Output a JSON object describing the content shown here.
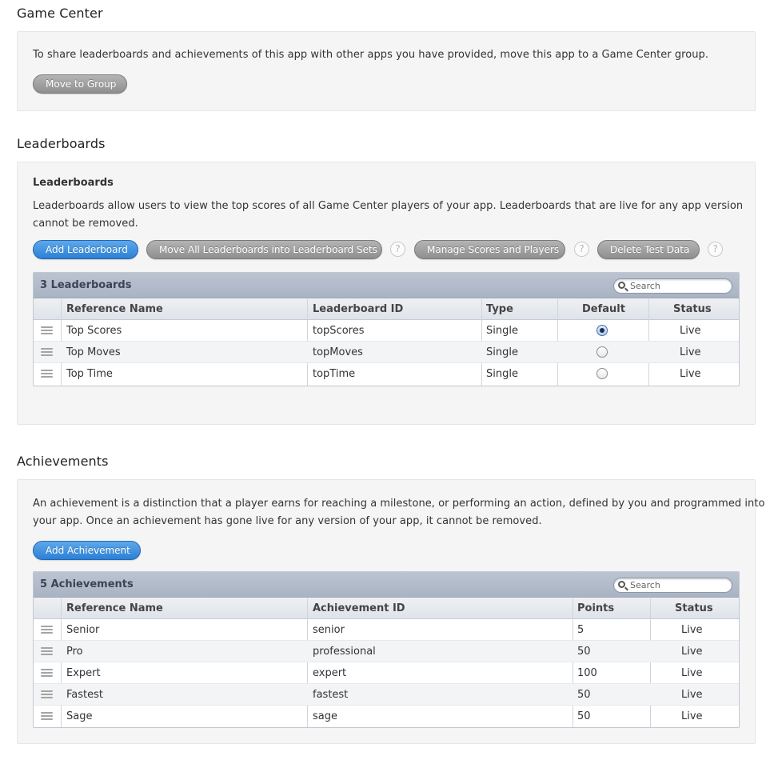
{
  "game_center": {
    "title": "Game Center",
    "description": "To share leaderboards and achievements of this app with other apps you have provided, move this app to a Game Center group.",
    "move_button": "Move to Group"
  },
  "leaderboards": {
    "title": "Leaderboards",
    "panel_heading": "Leaderboards",
    "description_line1": "Leaderboards allow users to view the top scores of all Game Center players of your app. Leaderboards that are live for any app version",
    "description_line2": "cannot be removed.",
    "buttons": {
      "add": "Add Leaderboard",
      "move_all": "Move All Leaderboards into Leaderboard Sets",
      "manage": "Manage Scores and Players",
      "delete": "Delete Test Data"
    },
    "help_glyph": "?",
    "table": {
      "title": "3 Leaderboards",
      "search_placeholder": "Search",
      "headers": {
        "reference_name": "Reference Name",
        "leaderboard_id": "Leaderboard ID",
        "type": "Type",
        "default": "Default",
        "status": "Status"
      },
      "rows": [
        {
          "reference_name": "Top Scores",
          "leaderboard_id": "topScores",
          "type": "Single",
          "default": true,
          "status": "Live"
        },
        {
          "reference_name": "Top Moves",
          "leaderboard_id": "topMoves",
          "type": "Single",
          "default": false,
          "status": "Live"
        },
        {
          "reference_name": "Top Time",
          "leaderboard_id": "topTime",
          "type": "Single",
          "default": false,
          "status": "Live"
        }
      ]
    }
  },
  "achievements": {
    "title": "Achievements",
    "description_line1": "An achievement is a distinction that a player earns for reaching a milestone, or performing an action, defined by you and programmed into",
    "description_line2": "your app. Once an achievement has gone live for any version of your app, it cannot be removed.",
    "add_button": "Add Achievement",
    "table": {
      "title": "5 Achievements",
      "search_placeholder": "Search",
      "headers": {
        "reference_name": "Reference Name",
        "achievement_id": "Achievement ID",
        "points": "Points",
        "status": "Status"
      },
      "rows": [
        {
          "reference_name": "Senior",
          "achievement_id": "senior",
          "points": "5",
          "status": "Live"
        },
        {
          "reference_name": "Pro",
          "achievement_id": "professional",
          "points": "50",
          "status": "Live"
        },
        {
          "reference_name": "Expert",
          "achievement_id": "expert",
          "points": "100",
          "status": "Live"
        },
        {
          "reference_name": "Fastest",
          "achievement_id": "fastest",
          "points": "50",
          "status": "Live"
        },
        {
          "reference_name": "Sage",
          "achievement_id": "sage",
          "points": "50",
          "status": "Live"
        }
      ]
    }
  },
  "colors": {
    "primary_button": "#2c7fd6",
    "secondary_button": "#8f8f8f",
    "table_title_bar": "#a9b3c3"
  },
  "icons": {
    "search": "search-icon",
    "drag_handle": "drag-handle-icon",
    "help": "help-icon"
  }
}
